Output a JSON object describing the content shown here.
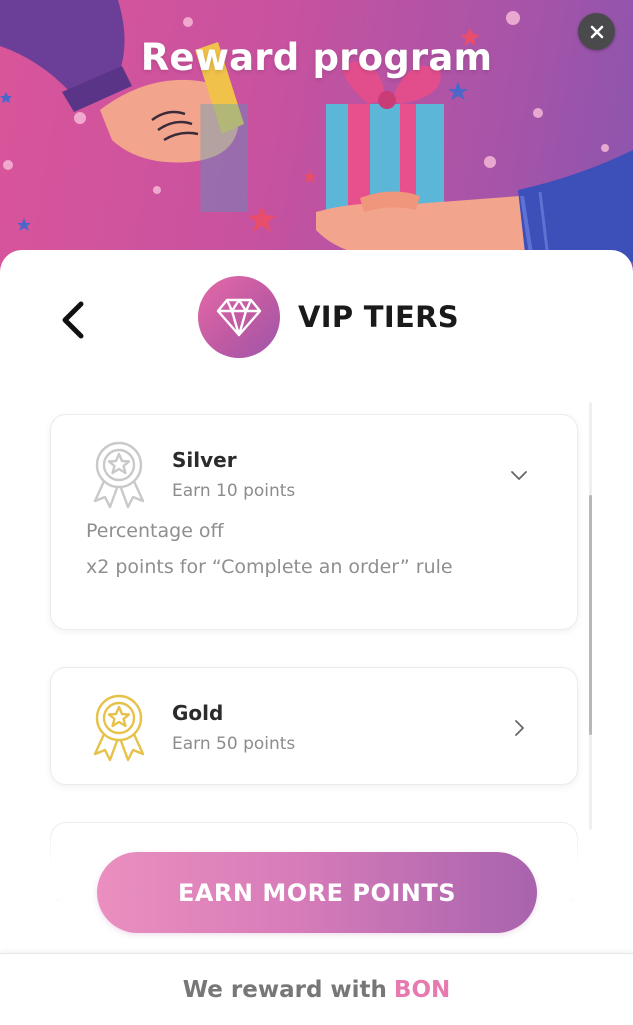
{
  "header": {
    "title": "Reward program",
    "close_icon": "close-icon",
    "colors": {
      "gradient_start": "#d9559a",
      "gradient_end": "#8a55ae"
    }
  },
  "panel": {
    "title": "VIP TIERS",
    "back_icon": "chevron-left-icon",
    "badge_icon": "diamond-icon"
  },
  "tiers": [
    {
      "name": "Silver",
      "points": "Earn 10 points",
      "expanded": true,
      "icon": "silver-medal-icon",
      "benefits": [
        "Percentage off",
        "x2 points for “Complete an order” rule"
      ]
    },
    {
      "name": "Gold",
      "points": "Earn 50 points",
      "expanded": false,
      "icon": "gold-medal-icon"
    }
  ],
  "actions": {
    "earn_more_label": "EARN MORE POINTS"
  },
  "footer": {
    "prefix": "We reward with",
    "brand": "BON",
    "brand_color": "#e77bb0"
  }
}
